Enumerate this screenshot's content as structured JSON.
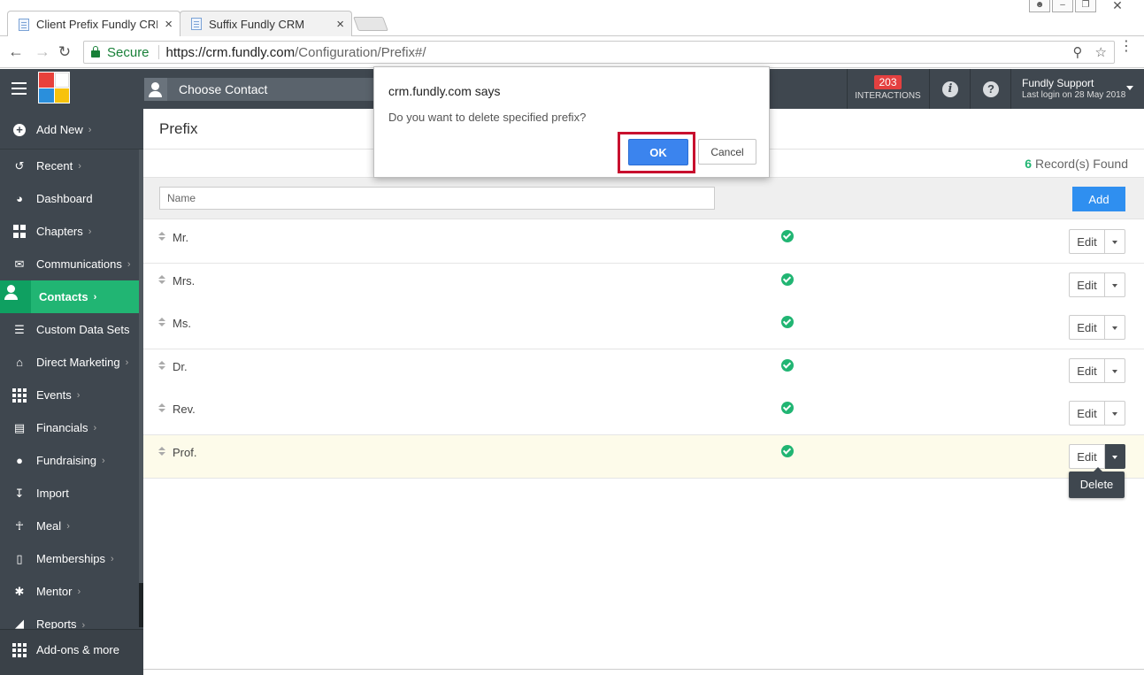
{
  "browser": {
    "tabs": [
      {
        "title": "Client Prefix Fundly CRM",
        "close": "×"
      },
      {
        "title": "Suffix Fundly CRM",
        "close": "×"
      }
    ],
    "security_label": "Secure",
    "url_host": "https://crm.fundly.com",
    "url_path": "/Configuration/Prefix#/"
  },
  "header": {
    "choose_contact": "Choose Contact",
    "interactions_count": "203",
    "interactions_label": "INTERACTIONS",
    "user_name": "Fundly Support",
    "last_login": "Last login on 28 May 2018"
  },
  "sidebar": {
    "add_new": "Add New",
    "items": [
      {
        "label": "Recent",
        "chevron": true
      },
      {
        "label": "Dashboard",
        "chevron": false
      },
      {
        "label": "Chapters",
        "chevron": true
      },
      {
        "label": "Communications",
        "chevron": true
      },
      {
        "label": "Contacts",
        "chevron": true,
        "active": true
      },
      {
        "label": "Custom Data Sets",
        "chevron": false
      },
      {
        "label": "Direct Marketing",
        "chevron": true
      },
      {
        "label": "Events",
        "chevron": true
      },
      {
        "label": "Financials",
        "chevron": true
      },
      {
        "label": "Fundraising",
        "chevron": true
      },
      {
        "label": "Import",
        "chevron": false
      },
      {
        "label": "Meal",
        "chevron": true
      },
      {
        "label": "Memberships",
        "chevron": true
      },
      {
        "label": "Mentor",
        "chevron": true
      },
      {
        "label": "Reports",
        "chevron": true
      }
    ],
    "addons": "Add-ons & more"
  },
  "main": {
    "title": "Prefix",
    "records_count": "6",
    "records_label": " Record(s) Found",
    "name_placeholder": "Name",
    "add_label": "Add",
    "rows": [
      {
        "name": "Mr.",
        "active": true
      },
      {
        "name": "Mrs.",
        "active": true
      },
      {
        "name": "Ms.",
        "active": true
      },
      {
        "name": "Dr.",
        "active": true
      },
      {
        "name": "Rev.",
        "active": true
      },
      {
        "name": "Prof.",
        "active": true,
        "highlighted": true
      }
    ],
    "edit_label": "Edit",
    "delete_label": "Delete"
  },
  "dialog": {
    "title": "crm.fundly.com says",
    "message": "Do you want to delete specified prefix?",
    "ok_label": "OK",
    "cancel_label": "Cancel"
  },
  "colors": {
    "sidebar_bg": "#3f474f",
    "accent_green": "#21b573",
    "primary_blue": "#2f8ff0",
    "badge_red": "#e44040",
    "highlight_red": "#c8102e"
  }
}
